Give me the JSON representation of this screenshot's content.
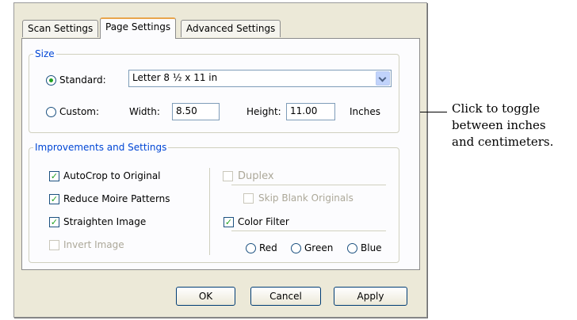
{
  "tabs": [
    {
      "label": "Scan Settings"
    },
    {
      "label": "Page Settings"
    },
    {
      "label": "Advanced Settings"
    }
  ],
  "size": {
    "legend": "Size",
    "standard_label": "Standard:",
    "standard_value": "Letter 8 ½ x 11 in",
    "custom_label": "Custom:",
    "width_label": "Width:",
    "width_value": "8.50",
    "height_label": "Height:",
    "height_value": "11.00",
    "units_label": "Inches"
  },
  "improvements": {
    "legend": "Improvements and Settings",
    "autocrop": "AutoCrop to Original",
    "moire": "Reduce Moire Patterns",
    "straighten": "Straighten Image",
    "invert": "Invert Image",
    "duplex": "Duplex",
    "skip_blank": "Skip Blank Originals",
    "color_filter": "Color Filter",
    "red": "Red",
    "green": "Green",
    "blue": "Blue"
  },
  "buttons": {
    "ok": "OK",
    "cancel": "Cancel",
    "apply": "Apply"
  },
  "callout": {
    "line1": "Click to toggle",
    "line2": "between inches",
    "line3": "and centimeters."
  },
  "state": {
    "selected_tab": "Page Settings",
    "size_mode": "Standard",
    "autocrop_checked": true,
    "moire_checked": true,
    "straighten_checked": true,
    "invert_checked": false,
    "duplex_checked": false,
    "skip_blank_checked": false,
    "color_filter_checked": true
  },
  "colors": {
    "dialog_bg": "#ece9d8",
    "legend_text": "#0046d5",
    "check_mark": "#21a121"
  }
}
